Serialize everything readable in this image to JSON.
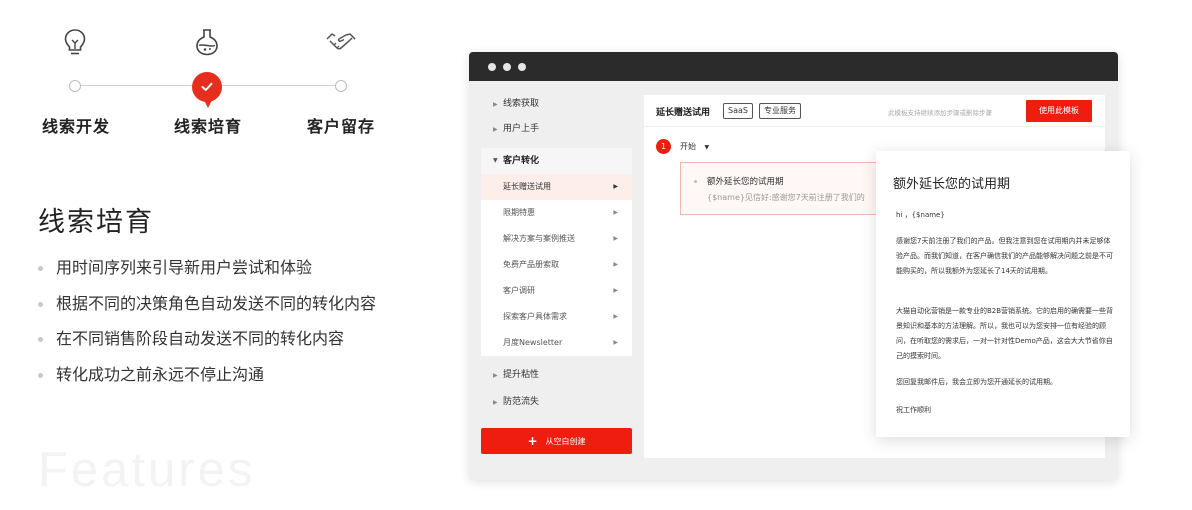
{
  "stepper": {
    "steps": [
      {
        "label": "线索开发",
        "icon": "lightbulb-icon",
        "state": "done"
      },
      {
        "label": "线索培育",
        "icon": "flask-icon",
        "state": "active"
      },
      {
        "label": "客户留存",
        "icon": "handshake-icon",
        "state": "pending"
      }
    ]
  },
  "section": {
    "title": "线索培育",
    "bullets": [
      "用时间序列来引导新用户尝试和体验",
      "根据不同的决策角色自动发送不同的转化内容",
      "在不同销售阶段自动发送不同的转化内容",
      "转化成功之前永远不停止沟通"
    ],
    "watermark": "Features"
  },
  "colors": {
    "accent": "#ef1d0f",
    "active_step": "#e62e1f",
    "titlebar": "#2b2b2b"
  },
  "app": {
    "sidebar": {
      "top_items": [
        "线索获取",
        "用户上手"
      ],
      "group": {
        "label": "客户转化",
        "items": [
          "延长赠送试用",
          "限期特惠",
          "解决方案与案例推送",
          "免费产品册索取",
          "客户调研",
          "探索客户具体需求",
          "月度Newsletter"
        ]
      },
      "bottom_items": [
        "提升粘性",
        "防范流失"
      ],
      "create_button": "从空白创建"
    },
    "header": {
      "title": "延长赠送试用",
      "tags": [
        "SaaS",
        "专业服务"
      ],
      "hint": "此模板支持继续添加步骤或删除步骤",
      "use_button": "使用此模板"
    },
    "flow": {
      "step_number": "1",
      "start_label": "开始",
      "card_title": "额外延长您的试用期",
      "card_body": "{$name}见信好:感谢您7天前注册了我们的"
    },
    "popup": {
      "title": "额外延长您的试用期",
      "greeting": "hi ，{$name}",
      "para1": "感谢您7天前注册了我们的产品。但我注意到您在试用期内并未足够体验产品。而我们知道，在客户确信我们的产品能够解决问题之前是不可能购买的，所以我额外为您延长了14天的试用期。",
      "para2": "大猫自动化营销是一款专业的B2B营销系统。它的启用的确需要一些背景知识和基本的方法理解。所以，我也可以为您安排一位有经验的顾问，在听取您的需求后，一对一针对性Demo产品，这会大大节省你自己的摸索时间。",
      "para3": "您回复我邮件后，我会立即为您开通延长的试用期。",
      "closing": "祝工作顺利"
    }
  }
}
